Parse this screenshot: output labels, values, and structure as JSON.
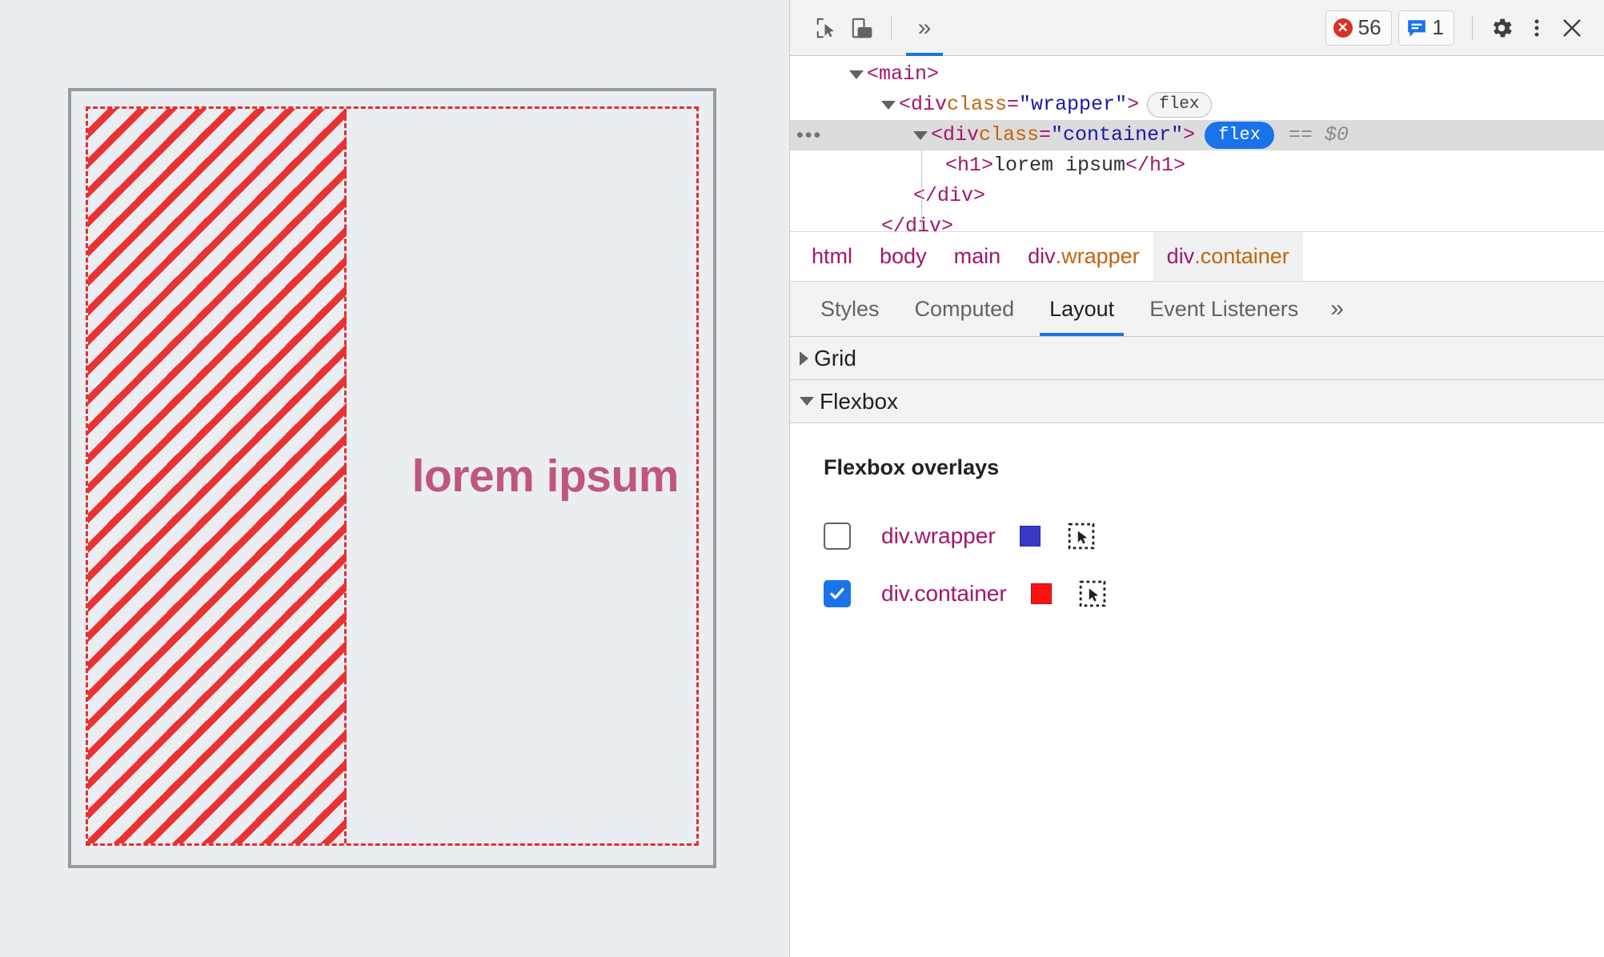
{
  "page": {
    "heading": "lorem ipsum",
    "heading_color": "#c0567e",
    "overlay_color": "#e62e2e",
    "page_bg": "#eaedf1"
  },
  "devtools": {
    "toolbar": {
      "inspect_icon": "inspect-cursor-icon",
      "device_icon": "device-toolbar-icon",
      "more_panels_icon": "chevron-double-right-icon",
      "error_count": "56",
      "message_count": "1",
      "settings_icon": "gear-icon",
      "menu_icon": "kebab-menu-icon",
      "close_icon": "close-icon",
      "accent": "#1a73e8",
      "error_color": "#d93025"
    },
    "dom_tree": [
      {
        "indent": 1,
        "expander": "down",
        "parts": [
          {
            "t": "tag",
            "v": "<main>"
          }
        ]
      },
      {
        "indent": 2,
        "expander": "down",
        "parts": [
          {
            "t": "tag",
            "v": "<div "
          },
          {
            "t": "attr-name",
            "v": "class"
          },
          {
            "t": "tag",
            "v": "="
          },
          {
            "t": "attr-val",
            "v": "\"wrapper\""
          },
          {
            "t": "tag",
            "v": ">"
          }
        ],
        "badge": "flex",
        "badge_style": "outline"
      },
      {
        "indent": 3,
        "expander": "down",
        "selected": true,
        "ellipsis": "•••",
        "parts": [
          {
            "t": "tag",
            "v": "<div "
          },
          {
            "t": "attr-name",
            "v": "class"
          },
          {
            "t": "tag",
            "v": "="
          },
          {
            "t": "attr-val",
            "v": "\"container\""
          },
          {
            "t": "tag",
            "v": ">"
          }
        ],
        "badge": "flex",
        "badge_style": "filled",
        "suffix": "== $0"
      },
      {
        "indent": 4,
        "expander": "none",
        "parts": [
          {
            "t": "tag",
            "v": "<h1>"
          },
          {
            "t": "txt",
            "v": "lorem ipsum"
          },
          {
            "t": "tag",
            "v": "</h1>"
          }
        ]
      },
      {
        "indent": 3,
        "expander": "none",
        "parts": [
          {
            "t": "tag",
            "v": "</div>"
          }
        ]
      },
      {
        "indent": 2,
        "expander": "none",
        "parts": [
          {
            "t": "tag",
            "v": "</div>"
          }
        ]
      }
    ],
    "breadcrumb": [
      {
        "tag": "html",
        "cls": "",
        "active": false
      },
      {
        "tag": "body",
        "cls": "",
        "active": false
      },
      {
        "tag": "main",
        "cls": "",
        "active": false
      },
      {
        "tag": "div",
        "cls": ".wrapper",
        "active": false
      },
      {
        "tag": "div",
        "cls": ".container",
        "active": true
      }
    ],
    "panel_tabs": [
      {
        "label": "Styles",
        "active": false
      },
      {
        "label": "Computed",
        "active": false
      },
      {
        "label": "Layout",
        "active": true
      },
      {
        "label": "Event Listeners",
        "active": false
      }
    ],
    "panel_tabs_more": "»",
    "sections": {
      "grid": {
        "label": "Grid",
        "expanded": false
      },
      "flexbox": {
        "label": "Flexbox",
        "expanded": true
      }
    },
    "flexbox_overlays": {
      "title": "Flexbox overlays",
      "items": [
        {
          "label": "div.wrapper",
          "checked": false,
          "color": "#3838c4"
        },
        {
          "label": "div.container",
          "checked": true,
          "color": "#ff1111"
        }
      ]
    }
  }
}
